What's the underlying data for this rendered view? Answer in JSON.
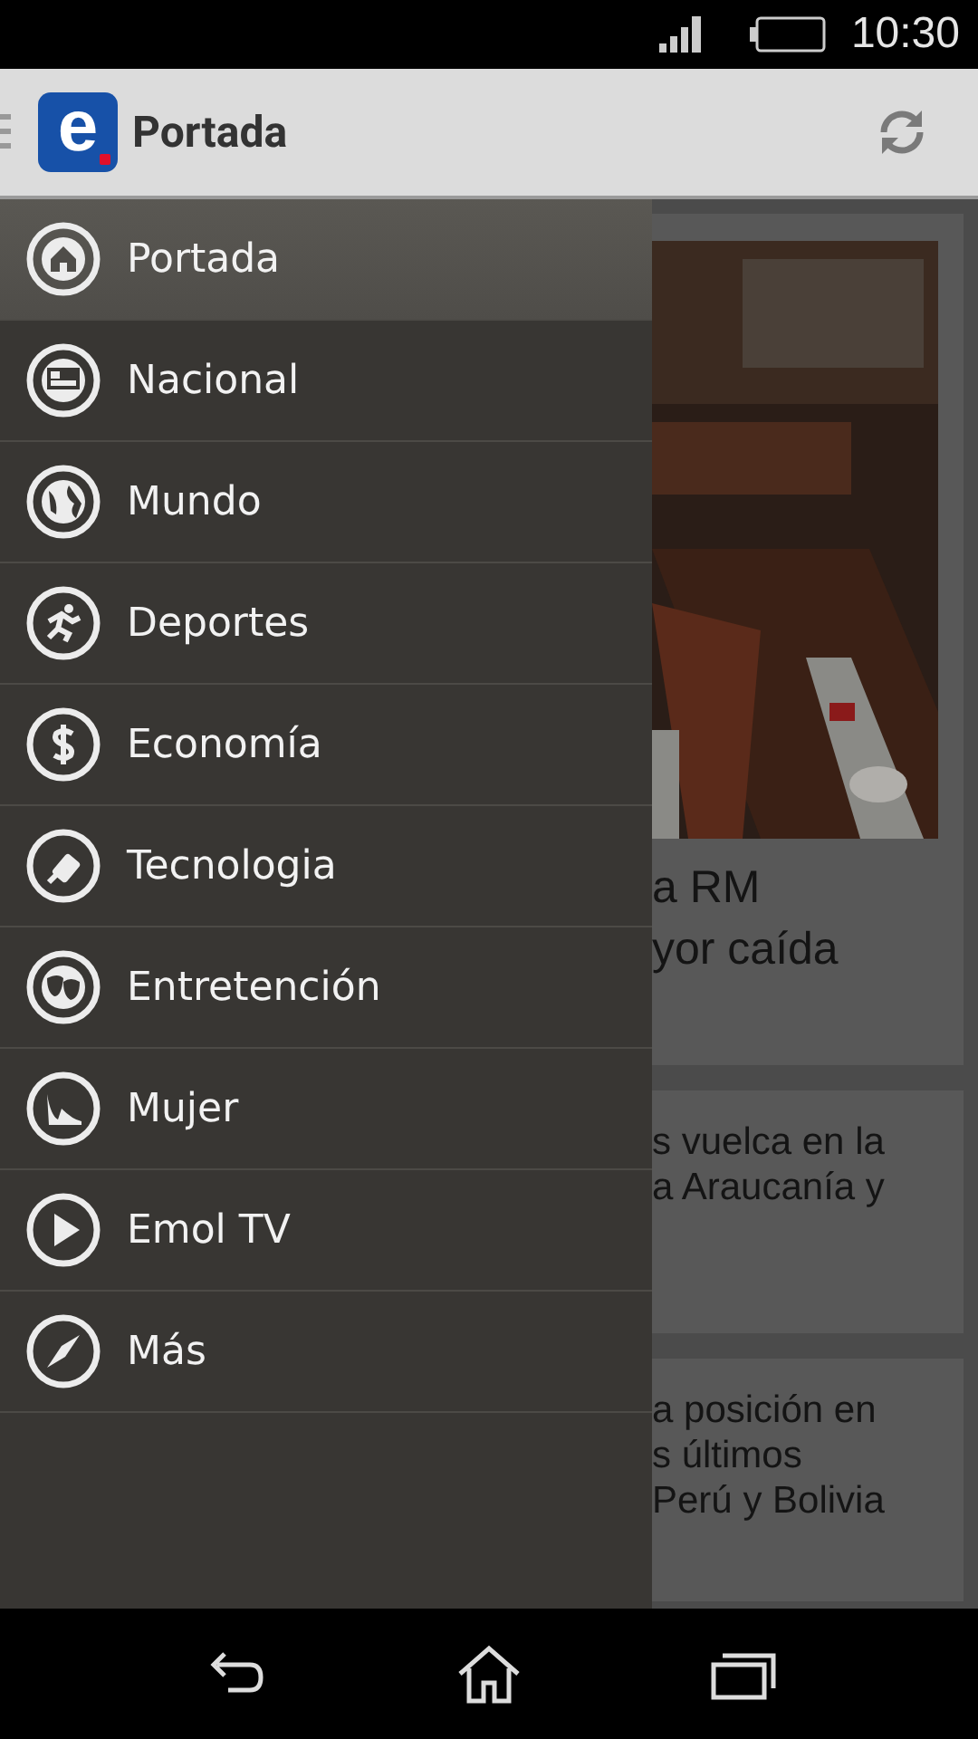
{
  "status_bar": {
    "time": "10:30"
  },
  "app_bar": {
    "logo_letter": "e",
    "title": "Portada"
  },
  "drawer": {
    "items": [
      {
        "label": "Portada",
        "selected": true
      },
      {
        "label": "Nacional",
        "selected": false
      },
      {
        "label": "Mundo",
        "selected": false
      },
      {
        "label": "Deportes",
        "selected": false
      },
      {
        "label": "Economía",
        "selected": false
      },
      {
        "label": "Tecnologia",
        "selected": false
      },
      {
        "label": "Entretención",
        "selected": false
      },
      {
        "label": "Mujer",
        "selected": false
      },
      {
        "label": "Emol TV",
        "selected": false
      },
      {
        "label": "Más",
        "selected": false
      }
    ]
  },
  "feed": [
    {
      "kind": "picture",
      "headline": [
        "a RM",
        "yor caída"
      ]
    },
    {
      "kind": "text",
      "headline": [
        "s vuelca en la",
        "a Araucanía y"
      ]
    },
    {
      "kind": "text",
      "headline": [
        "a posición en",
        "s últimos",
        "Perú y Bolivia"
      ]
    }
  ]
}
